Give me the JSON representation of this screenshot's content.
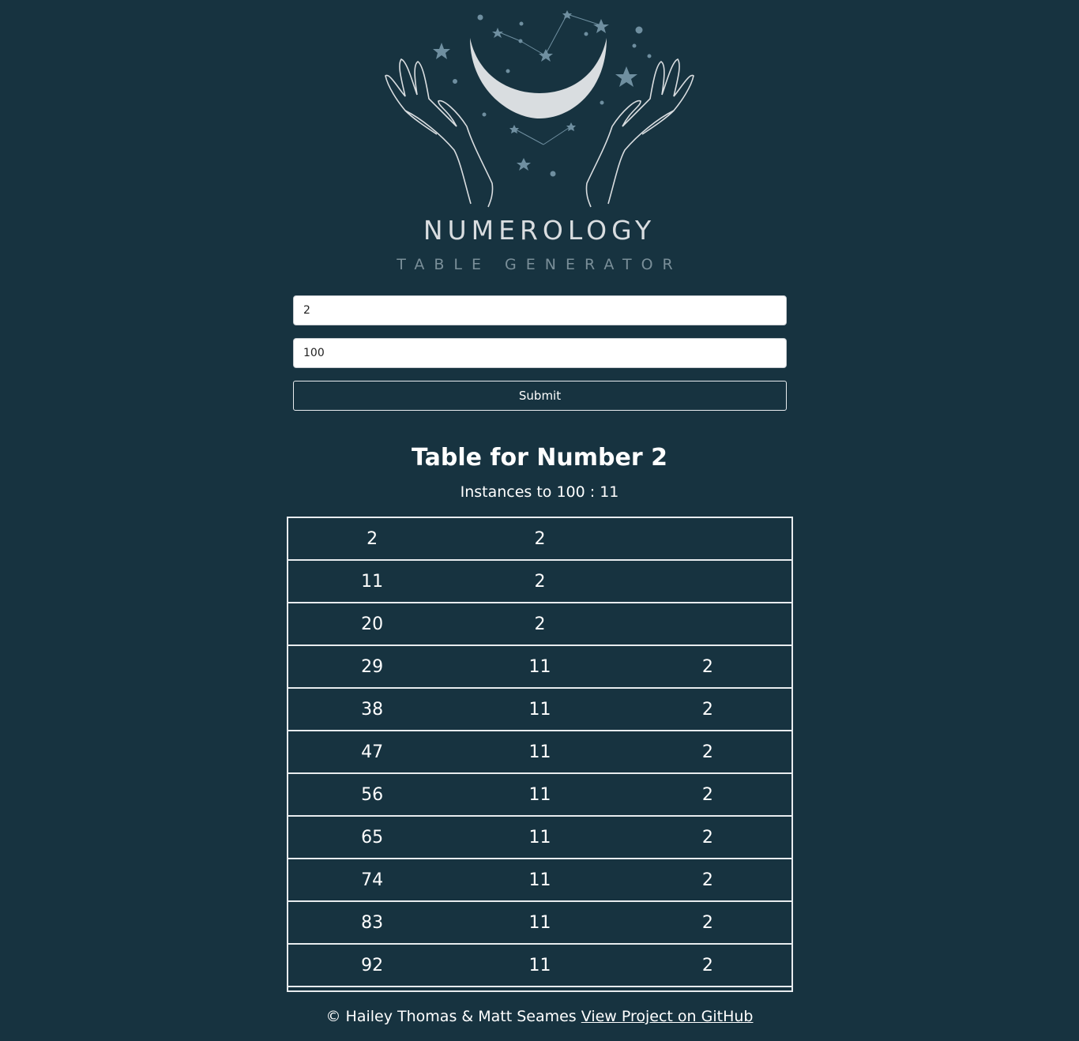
{
  "logo": {
    "title": "NUMEROLOGY",
    "subtitle": "TABLE GENERATOR"
  },
  "form": {
    "number_value": "2",
    "limit_value": "100",
    "submit_label": "Submit"
  },
  "result": {
    "title": "Table for Number 2",
    "instances": "Instances to 100 : 11"
  },
  "table": {
    "rows": [
      [
        "2",
        "2",
        ""
      ],
      [
        "11",
        "2",
        ""
      ],
      [
        "20",
        "2",
        ""
      ],
      [
        "29",
        "11",
        "2"
      ],
      [
        "38",
        "11",
        "2"
      ],
      [
        "47",
        "11",
        "2"
      ],
      [
        "56",
        "11",
        "2"
      ],
      [
        "65",
        "11",
        "2"
      ],
      [
        "74",
        "11",
        "2"
      ],
      [
        "83",
        "11",
        "2"
      ],
      [
        "92",
        "11",
        "2"
      ]
    ]
  },
  "footer": {
    "credit": "© Hailey Thomas & Matt Seames",
    "link_label": "View Project on GitHub"
  },
  "colors": {
    "background": "#173340",
    "accent_star": "#6f8fa0",
    "moon": "#d9dde0"
  }
}
